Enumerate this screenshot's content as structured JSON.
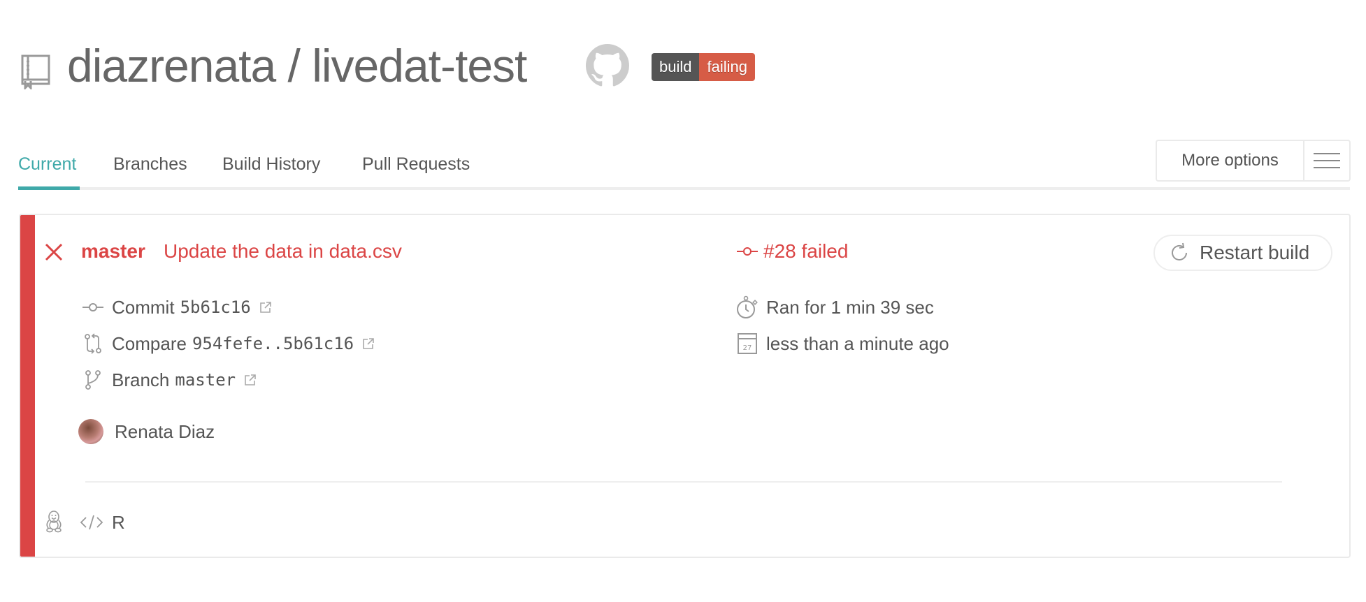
{
  "header": {
    "repo_owner": "diazrenata",
    "separator": "/",
    "repo_name": "livedat-test",
    "title": "diazrenata / livedat-test",
    "icons": {
      "repo": "repo-book-icon",
      "github": "github-icon"
    },
    "badge": {
      "left": "build",
      "right": "failing",
      "left_color": "#555555",
      "right_color": "#d65c46"
    }
  },
  "tabs": [
    {
      "label": "Current",
      "active": true
    },
    {
      "label": "Branches",
      "active": false
    },
    {
      "label": "Build History",
      "active": false
    },
    {
      "label": "Pull Requests",
      "active": false
    }
  ],
  "more_options": {
    "label": "More options",
    "menu_icon": "hamburger-icon"
  },
  "build": {
    "status": "failed",
    "status_color": "#db4545",
    "accent_color": "#3fa9a9",
    "branch": "master",
    "commit_message": "Update the data in data.csv",
    "number_label": "#28 failed",
    "restart_label": "Restart build",
    "commit": {
      "label": "Commit",
      "value": "5b61c16"
    },
    "compare": {
      "label": "Compare",
      "value": "954fefe..5b61c16"
    },
    "branch_row": {
      "label": "Branch",
      "value": "master"
    },
    "duration": "Ran for 1 min 39 sec",
    "finished": "less than a minute ago",
    "calendar_day": "27",
    "author": "Renata Diaz",
    "os": "linux",
    "language": "R"
  }
}
